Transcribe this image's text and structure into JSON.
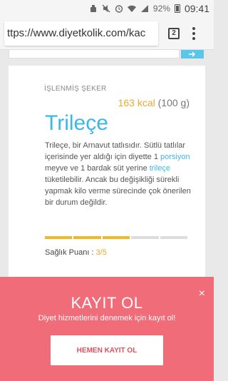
{
  "status_bar": {
    "battery": "92%",
    "time": "09:41"
  },
  "browser": {
    "url": "ttps://www.diyetkolik.com/kac",
    "tab_count": "2"
  },
  "search": {
    "button_icon": "arrow-icon"
  },
  "food": {
    "category": "İŞLENMİŞ ŞEKER",
    "calories": "163 kcal",
    "portion": "(100 g)",
    "title": "Trileçe",
    "desc_part1": "Trileçe, bir Arnavut tatlısıdır. Sütlü tatlılar içerisinde yer aldığı için diyette 1 ",
    "desc_link1": "porsiyon",
    "desc_part2": " meyve ve 1 bardak süt yerine ",
    "desc_link2": "trileçe",
    "desc_part3": " tüketilebilir. Ancak bu değişikliği sürekli yapmak kilo verme sürecinde çok önerilen bir durum değildir.",
    "health_score_level": 0.6,
    "health_label": "Sağlık Puanı : ",
    "health_value": "3/5"
  },
  "signup": {
    "title": "KAYIT OL",
    "subtitle": "Diyet hizmetlerini denemek için kayıt ol!",
    "button": "HEMEN KAYIT OL",
    "close": "×"
  },
  "colors": {
    "accent_blue": "#3bb8e8",
    "accent_orange": "#f0a830",
    "overlay": "#f06c78"
  }
}
